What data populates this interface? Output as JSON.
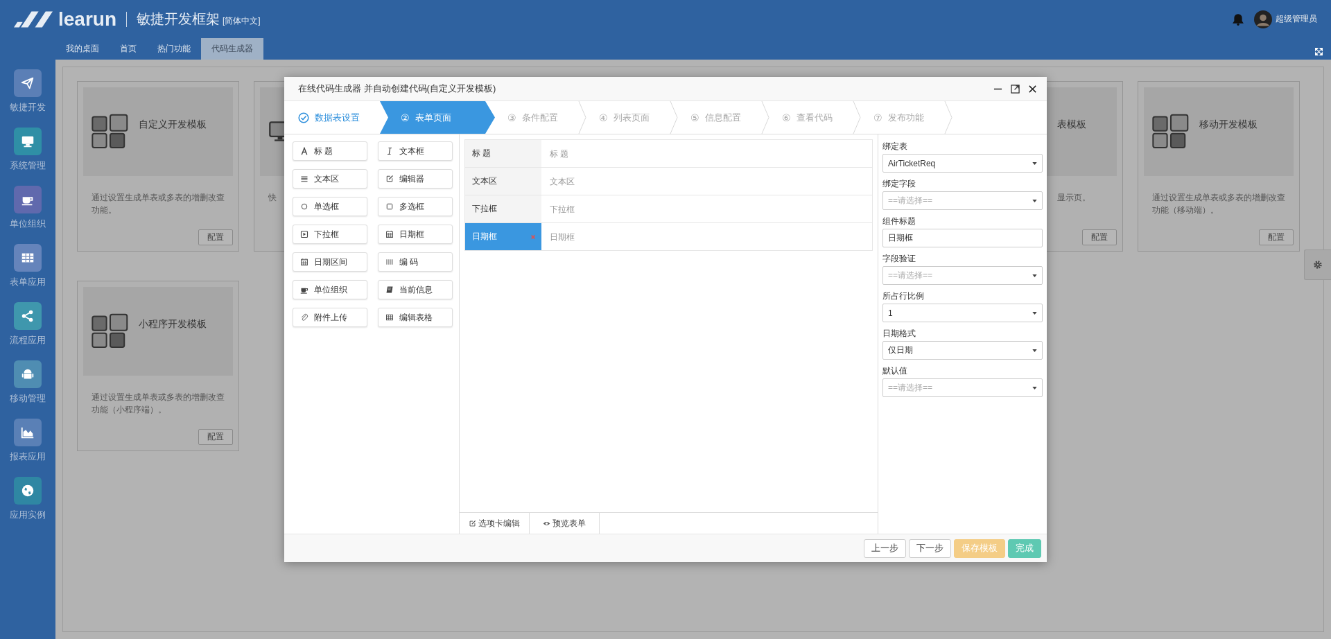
{
  "header": {
    "logo_text": "learun",
    "product": "敏捷开发框架",
    "language": "[简体中文]",
    "user": "超级管理员"
  },
  "tabs": [
    {
      "label": "我的桌面",
      "selected": false
    },
    {
      "label": "首页",
      "selected": false
    },
    {
      "label": "热门功能",
      "selected": false
    },
    {
      "label": "代码生成器",
      "selected": true
    }
  ],
  "sidebar": {
    "items": [
      {
        "label": "敏捷开发",
        "color": "#5b7fb6"
      },
      {
        "label": "系统管理",
        "color": "#2f8fa6"
      },
      {
        "label": "单位组织",
        "color": "#6069ad"
      },
      {
        "label": "表单应用",
        "color": "#6584bb"
      },
      {
        "label": "流程应用",
        "color": "#3f97ad"
      },
      {
        "label": "移动管理",
        "color": "#4f8db2"
      },
      {
        "label": "报表应用",
        "color": "#5a80b6"
      },
      {
        "label": "应用实例",
        "color": "#2f87a3"
      }
    ]
  },
  "cards": [
    {
      "kind": "tiles",
      "title": "自定义开发模板",
      "description": "通过设置生成单表或多表的增删改查功能。",
      "button": "配置"
    },
    {
      "kind": "monitor",
      "description": "快"
    },
    {
      "kind": "cut",
      "title": "表模板",
      "description": "显示页。",
      "button": "配置"
    },
    {
      "kind": "tiles",
      "title": "移动开发模板",
      "description": "通过设置生成单表或多表的增删改查功能（移动端）。",
      "button": "配置"
    },
    {
      "kind": "tiles",
      "title": "小程序开发模板",
      "description": "通过设置生成单表或多表的增删改查功能（小程序端）。",
      "button": "配置"
    }
  ],
  "dialog": {
    "title": "在线代码生成器 并自动创建代码(自定义开发模板)",
    "steps": [
      {
        "label": "数据表设置",
        "done": true,
        "selected": false
      },
      {
        "number": "②",
        "label": "表单页面",
        "done": false,
        "selected": true
      },
      {
        "number": "③",
        "label": "条件配置",
        "done": false,
        "selected": false
      },
      {
        "number": "④",
        "label": "列表页面",
        "done": false,
        "selected": false
      },
      {
        "number": "⑤",
        "label": "信息配置",
        "done": false,
        "selected": false
      },
      {
        "number": "⑥",
        "label": "查看代码",
        "done": false,
        "selected": false
      },
      {
        "number": "⑦",
        "label": "发布功能",
        "done": false,
        "selected": false
      }
    ],
    "components": [
      "标 题",
      "文本框",
      "文本区",
      "编辑器",
      "单选框",
      "多选框",
      "下拉框",
      "日期框",
      "日期区间",
      "编 码",
      "单位组织",
      "当前信息",
      "附件上传",
      "编辑表格"
    ],
    "form_rows": [
      {
        "label": "标 题",
        "placeholder": "标 题",
        "selected": false
      },
      {
        "label": "文本区",
        "placeholder": "文本区",
        "selected": false
      },
      {
        "label": "下拉框",
        "placeholder": "下拉框",
        "selected": false
      },
      {
        "label": "日期框",
        "placeholder": "日期框",
        "selected": true
      }
    ],
    "bottom_tabs": [
      "选项卡编辑",
      "预览表单"
    ],
    "properties": [
      {
        "label": "绑定表",
        "kind": "select",
        "value": "AirTicketReq"
      },
      {
        "label": "绑定字段",
        "kind": "select",
        "placeholder": "==请选择=="
      },
      {
        "label": "组件标题",
        "kind": "input",
        "value": "日期框"
      },
      {
        "label": "字段验证",
        "kind": "select",
        "placeholder": "==请选择=="
      },
      {
        "label": "所占行比例",
        "kind": "select",
        "value": "1"
      },
      {
        "label": "日期格式",
        "kind": "select",
        "value": "仅日期"
      },
      {
        "label": "默认值",
        "kind": "select",
        "placeholder": "==请选择=="
      }
    ],
    "buttons": [
      {
        "label": "上一步",
        "kind": "default"
      },
      {
        "label": "下一步",
        "kind": "default"
      },
      {
        "label": "保存模板",
        "kind": "warning"
      },
      {
        "label": "完成",
        "kind": "success"
      }
    ]
  }
}
